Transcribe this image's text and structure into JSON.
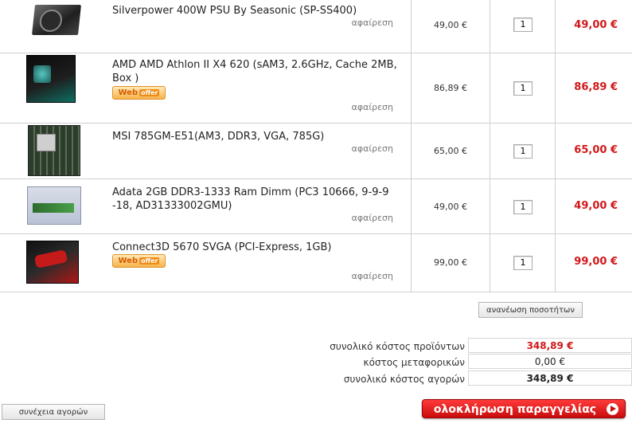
{
  "cart": {
    "items": [
      {
        "name": "Silverpower 400W PSU By Seasonic (SP-SS400)",
        "remove": "αφαίρεση",
        "unit_price": "49,00 €",
        "qty": "1",
        "total": "49,00 €",
        "image": "power-supply-image",
        "web_offer": false
      },
      {
        "name": "AMD AMD Athlon II X4 620 (sAM3, 2.6GHz, Cache 2MB, Box )",
        "remove": "αφαίρεση",
        "unit_price": "86,89 €",
        "qty": "1",
        "total": "86,89 €",
        "image": "cpu-box-image",
        "web_offer": true
      },
      {
        "name": "MSI 785GM-E51(AM3, DDR3, VGA, 785G)",
        "remove": "αφαίρεση",
        "unit_price": "65,00 €",
        "qty": "1",
        "total": "65,00 €",
        "image": "motherboard-image",
        "web_offer": false
      },
      {
        "name": "Adata 2GB DDR3-1333 Ram Dimm (PC3 10666, 9-9-9 -18, AD31333002GMU)",
        "remove": "αφαίρεση",
        "unit_price": "49,00 €",
        "qty": "1",
        "total": "49,00 €",
        "image": "ram-module-image",
        "web_offer": false
      },
      {
        "name": "Connect3D 5670 SVGA (PCI-Express, 1GB)",
        "remove": "αφαίρεση",
        "unit_price": "99,00 €",
        "qty": "1",
        "total": "99,00 €",
        "image": "graphics-card-image",
        "web_offer": true
      }
    ],
    "web_offer_label": "Web",
    "web_offer_badge": "offer",
    "update_label": "ανανέωση ποσοτήτων"
  },
  "summary": {
    "products_label": "συνολικό κόστος προϊόντων",
    "products_value": "348,89 €",
    "shipping_label": "κόστος μεταφορικών",
    "shipping_value": "0,00 €",
    "total_label": "συνολικό κόστος αγορών",
    "total_value": "348,89 €"
  },
  "actions": {
    "continue_label": "συνέχεια αγορών",
    "checkout_label": "ολοκλήρωση παραγγελίας"
  },
  "colors": {
    "price_red": "#d0181a",
    "checkout_red": "#c80d0d",
    "border_grey": "#cfcfcf"
  }
}
